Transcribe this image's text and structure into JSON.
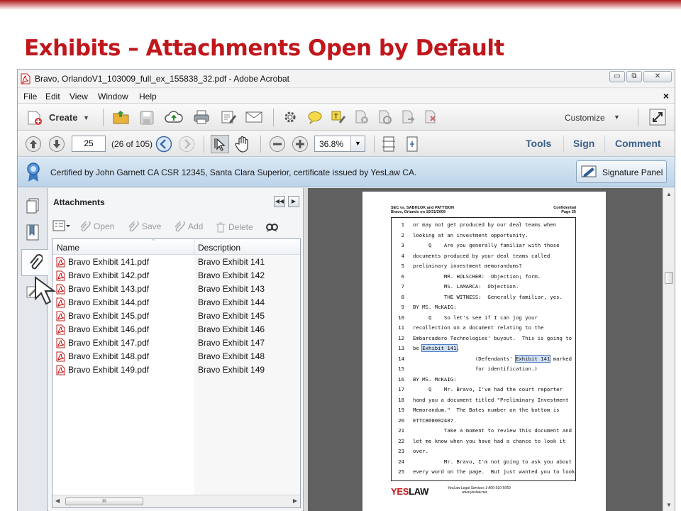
{
  "slide": {
    "title": "Exhibits – Attachments Open by Default"
  },
  "window": {
    "title": "Bravo, OrlandoV1_103009_full_ex_155838_32.pdf - Adobe Acrobat",
    "buttons": {
      "minimize": "▭",
      "restore": "⧉",
      "close": "✕"
    }
  },
  "menu": {
    "items": [
      "File",
      "Edit",
      "View",
      "Window",
      "Help"
    ],
    "close_doc": "×"
  },
  "toolbar": {
    "create_label": "Create",
    "customize_label": "Customize"
  },
  "nav": {
    "page_value": "25",
    "page_count": "(26 of 105)",
    "zoom_value": "36.8%",
    "tabs": [
      "Tools",
      "Sign",
      "Comment"
    ]
  },
  "cert": {
    "text": "Certified by John Garnett CA CSR 12345, Santa Clara Superior, certificate issued by YesLaw CA.",
    "signature_panel_label": "Signature Panel"
  },
  "attachments": {
    "title": "Attachments",
    "tools": {
      "open": "Open",
      "save": "Save",
      "add": "Add",
      "delete": "Delete"
    },
    "columns": {
      "name": "Name",
      "description": "Description"
    },
    "rows": [
      {
        "name": "Bravo Exhibit 141.pdf",
        "description": "Bravo Exhibit 141"
      },
      {
        "name": "Bravo Exhibit 142.pdf",
        "description": "Bravo Exhibit 142"
      },
      {
        "name": "Bravo Exhibit 143.pdf",
        "description": "Bravo Exhibit 143"
      },
      {
        "name": "Bravo Exhibit 144.pdf",
        "description": "Bravo Exhibit 144"
      },
      {
        "name": "Bravo Exhibit 145.pdf",
        "description": "Bravo Exhibit 145"
      },
      {
        "name": "Bravo Exhibit 146.pdf",
        "description": "Bravo Exhibit 146"
      },
      {
        "name": "Bravo Exhibit 147.pdf",
        "description": "Bravo Exhibit 147"
      },
      {
        "name": "Bravo Exhibit 148.pdf",
        "description": "Bravo Exhibit 148"
      },
      {
        "name": "Bravo Exhibit 149.pdf",
        "description": "Bravo Exhibit 149"
      }
    ],
    "scroll_grip": "III"
  },
  "document": {
    "header_left": [
      "SEC vs. SABHLOK and PATTISON",
      "Bravo, Orlando on 10/31/2009"
    ],
    "header_right": [
      "Confidential",
      "Page 25"
    ],
    "lines": [
      {
        "n": "1",
        "t": "or may not get produced by our deal teams when"
      },
      {
        "n": "2",
        "t": "looking at an investment opportunity."
      },
      {
        "n": "3",
        "t": "     Q    Are you generally familiar with those"
      },
      {
        "n": "4",
        "t": "documents produced by your deal teams called"
      },
      {
        "n": "5",
        "t": "preliminary investment memorandums?"
      },
      {
        "n": "6",
        "t": "          MR. HOLSCHER:  Objection; form."
      },
      {
        "n": "7",
        "t": "          MS. LAMARCA:  Objection."
      },
      {
        "n": "8",
        "t": "          THE WITNESS:  Generally familiar, yes."
      },
      {
        "n": "9",
        "t": "BY MS. McKAIG:"
      },
      {
        "n": "10",
        "t": "     Q    So let's see if I can jog your"
      },
      {
        "n": "11",
        "t": "recollection on a document relating to the"
      },
      {
        "n": "12",
        "t": "Embarcadero Technologies' buyout.  This is going to"
      },
      {
        "n": "13",
        "t": "be ",
        "hl": "Exhibit 141",
        "after": "."
      },
      {
        "n": "14",
        "t": "                    (Defendants' ",
        "hl": "Exhibit 141",
        "after": " marked"
      },
      {
        "n": "15",
        "t": "                    for identification.)"
      },
      {
        "n": "16",
        "t": "BY MS. McKAIG:"
      },
      {
        "n": "17",
        "t": "     Q    Mr. Bravo, I've had the court reporter"
      },
      {
        "n": "18",
        "t": "hand you a document titled \"Preliminary Investment"
      },
      {
        "n": "19",
        "t": "Memorandum.\"  The Bates number on the bottom is"
      },
      {
        "n": "20",
        "t": "ETTCB00002487."
      },
      {
        "n": "21",
        "t": "          Take a moment to review this document and"
      },
      {
        "n": "22",
        "t": "let me know when you have had a chance to look it"
      },
      {
        "n": "23",
        "t": "over."
      },
      {
        "n": "24",
        "t": "          Mr. Bravo, I'm not going to ask you about"
      },
      {
        "n": "25",
        "t": "every word on the page.  But just wanted you to look"
      }
    ],
    "footer_logo_yes": "YES",
    "footer_logo_law": "LAW",
    "footer_info": [
      "YesLaw Legal Services    1-800-910-5059",
      "www.yeslaw.net"
    ]
  },
  "colors": {
    "title_red": "#c0171c",
    "cert_bar": "#c9dcef",
    "tab_blue": "#3c5f8a"
  }
}
